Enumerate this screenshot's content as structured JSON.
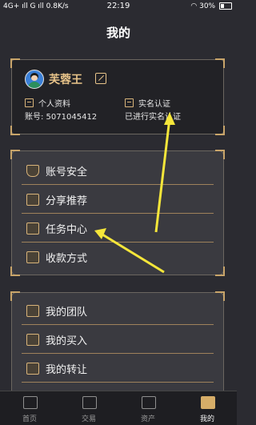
{
  "status_bar": {
    "left": "4G+ ıll  G ıll 0.8K/s",
    "time": "22:19",
    "battery_percent": "30%"
  },
  "header": {
    "title": "我的"
  },
  "profile": {
    "name": "芙蓉王",
    "personal_info_label": "个人资料",
    "account_label": "账号: 5071045412",
    "realname_label": "实名认证",
    "realname_status": "已进行实名认证"
  },
  "menu_group_1": [
    {
      "label": "账号安全",
      "icon": "shield-icon"
    },
    {
      "label": "分享推荐",
      "icon": "share-icon"
    },
    {
      "label": "任务中心",
      "icon": "task-icon"
    },
    {
      "label": "收款方式",
      "icon": "payment-icon"
    }
  ],
  "menu_group_2": [
    {
      "label": "我的团队",
      "icon": "team-icon"
    },
    {
      "label": "我的买入",
      "icon": "buy-icon"
    },
    {
      "label": "我的转让",
      "icon": "transfer-icon"
    }
  ],
  "bottom_nav": [
    {
      "label": "首页",
      "icon": "home-icon"
    },
    {
      "label": "交易",
      "icon": "trade-icon"
    },
    {
      "label": "资产",
      "icon": "assets-icon"
    },
    {
      "label": "我的",
      "icon": "profile-icon"
    }
  ],
  "colors": {
    "background": "#2b2b31",
    "accent_gold": "#d9b47a",
    "arrow_yellow": "#f5e63a"
  }
}
